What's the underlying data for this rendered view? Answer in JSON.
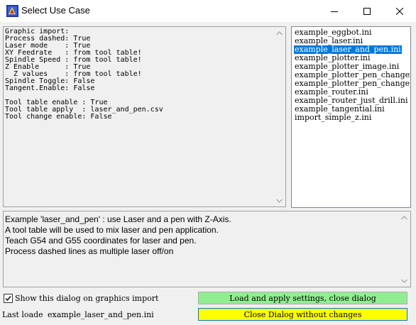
{
  "window": {
    "title": "Select Use Case"
  },
  "info_lines": [
    "Graphic import:",
    "Process dashed: True",
    "Laser mode    : True",
    "XY Feedrate   : from tool table!",
    "Spindle Speed : from tool table!",
    "Z Enable      : True",
    "  Z values    : from tool table!",
    "Spindle Toggle: False",
    "Tangent.Enable: False",
    "",
    "Tool table enable : True",
    "Tool table apply  : laser_and_pen.csv",
    "Tool change enable: False"
  ],
  "file_list": {
    "items": [
      "example_eggbot.ini",
      "example_laser.ini",
      "example_laser_and_pen.ini",
      "example_plotter.ini",
      "example_plotter_image.ini",
      "example_plotter_pen_changer_",
      "example_plotter_pen_change_m",
      "example_router.ini",
      "example_router_just_drill.ini",
      "example_tangential.ini",
      "import_simple_z.ini"
    ],
    "selected_index": 2
  },
  "description": [
    "Example 'laser_and_pen' : use Laser and a pen with Z-Axis.",
    "A tool table will be used to mix laser and pen application.",
    "Teach G54 and G55 coordinates for laser and pen.",
    "Process dashed lines as multiple laser off/on"
  ],
  "show_dialog": {
    "label": "Show this dialog on graphics import",
    "checked": true
  },
  "last_loaded": {
    "label": "Last loade",
    "value": "example_laser_and_pen.ini"
  },
  "buttons": {
    "load_label": "Load and apply settings, close dialog",
    "load_color": "#90ee90",
    "close_label": "Close Dialog without changes",
    "close_color": "#ffff00"
  },
  "colors": {
    "selection": "#0078d7"
  }
}
